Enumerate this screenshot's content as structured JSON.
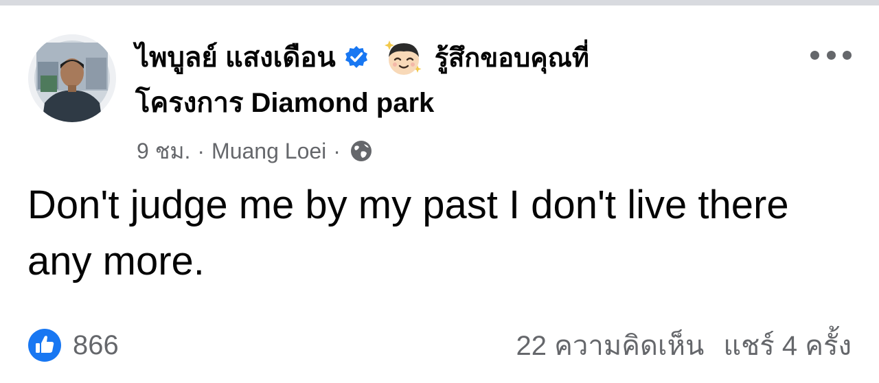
{
  "post": {
    "author_name": "ไพบูลย์ แสงเดือน",
    "feeling_text": "รู้สึกขอบคุณที่",
    "place_name": "โครงการ Diamond park",
    "time": "9 ชม.",
    "separator": "·",
    "location": "Muang Loei",
    "body": "Don't judge me by my past I don't live there any more.",
    "icons": {
      "verified": "verified-badge-icon",
      "feeling": "grateful-face-emoji-icon",
      "privacy": "globe-icon",
      "more": "more-options-icon",
      "like": "like-thumbs-up-icon"
    }
  },
  "stats": {
    "likes": "866",
    "comments": "22 ความคิดเห็น",
    "shares": "แชร์ 4 ครั้ง"
  },
  "colors": {
    "primary_text": "#050505",
    "secondary_text": "#65676b",
    "facebook_blue": "#1877f2"
  }
}
